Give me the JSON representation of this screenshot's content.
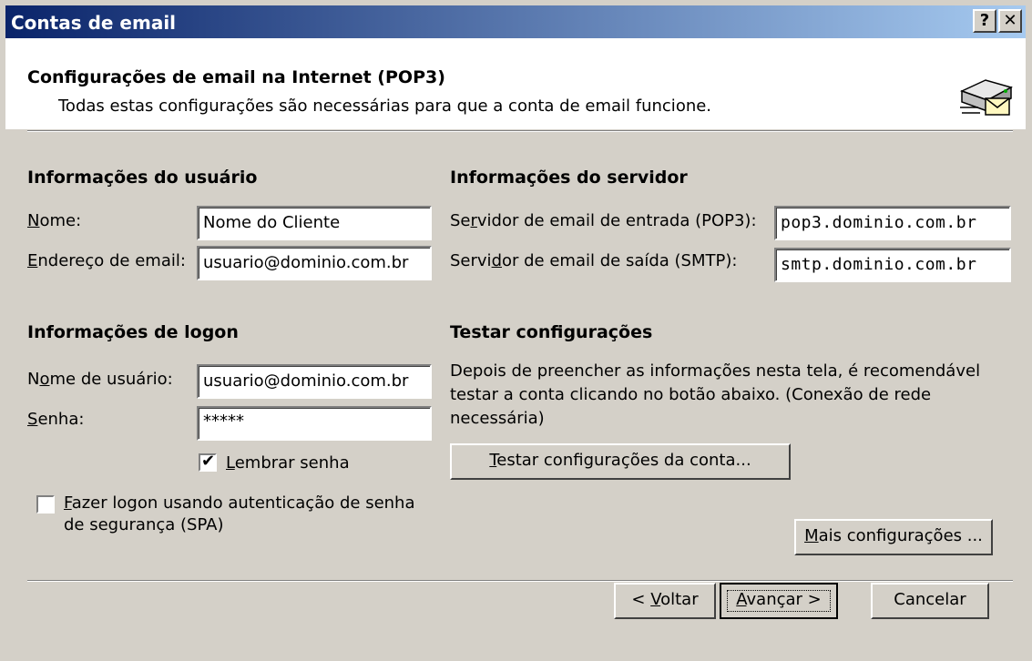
{
  "window": {
    "title": "Contas de email",
    "help_glyph": "?",
    "close_glyph": "✕"
  },
  "header": {
    "title": "Configurações de email na Internet (POP3)",
    "subtitle": "Todas estas configurações são necessárias para que a conta de email funcione.",
    "icon": "mail-server-icon"
  },
  "user_info": {
    "heading": "Informações do usuário",
    "name_label_u": "N",
    "name_label_rest": "ome:",
    "name_value": "Nome do Cliente",
    "email_label_u": "E",
    "email_label_rest": "ndereço de email:",
    "email_value": "usuario@dominio.com.br"
  },
  "server_info": {
    "heading": "Informações do servidor",
    "incoming_label_a": "Se",
    "incoming_label_u": "r",
    "incoming_label_rest": "vidor de email de entrada (POP3):",
    "incoming_value": "pop3.dominio.com.br",
    "outgoing_label_a": "Servi",
    "outgoing_label_u": "d",
    "outgoing_label_rest": "or de email de saída (SMTP):",
    "outgoing_value": "smtp.dominio.com.br"
  },
  "logon_info": {
    "heading": "Informações de logon",
    "username_label_a": "N",
    "username_label_u": "o",
    "username_label_rest": "me de usuário:",
    "username_value": "usuario@dominio.com.br",
    "password_label_u": "S",
    "password_label_rest": "enha:",
    "password_value": "*****",
    "remember_checked": true,
    "remember_label_u": "L",
    "remember_label_rest": "embrar senha",
    "spa_checked": false,
    "spa_label_u": "F",
    "spa_label_line1_rest": "azer logon usando autenticação de senha",
    "spa_label_line2": "de segurança (SPA)"
  },
  "test": {
    "heading": "Testar configurações",
    "description_line1": "Depois de preencher as informações nesta tela, é recomendável",
    "description_line2": "testar a conta clicando no botão abaixo. (Conexão de rede",
    "description_line3": "necessária)",
    "button_u": "T",
    "button_rest": "estar configurações da conta..."
  },
  "more_settings": {
    "u": "M",
    "rest": "ais configurações ..."
  },
  "footer": {
    "back_prefix": "< ",
    "back_u": "V",
    "back_rest": "oltar",
    "next_u": "A",
    "next_rest": "vançar >",
    "cancel": "Cancelar"
  },
  "colors": {
    "face": "#d4d0c8",
    "title_start": "#0a246a",
    "title_end": "#a6caf0"
  }
}
